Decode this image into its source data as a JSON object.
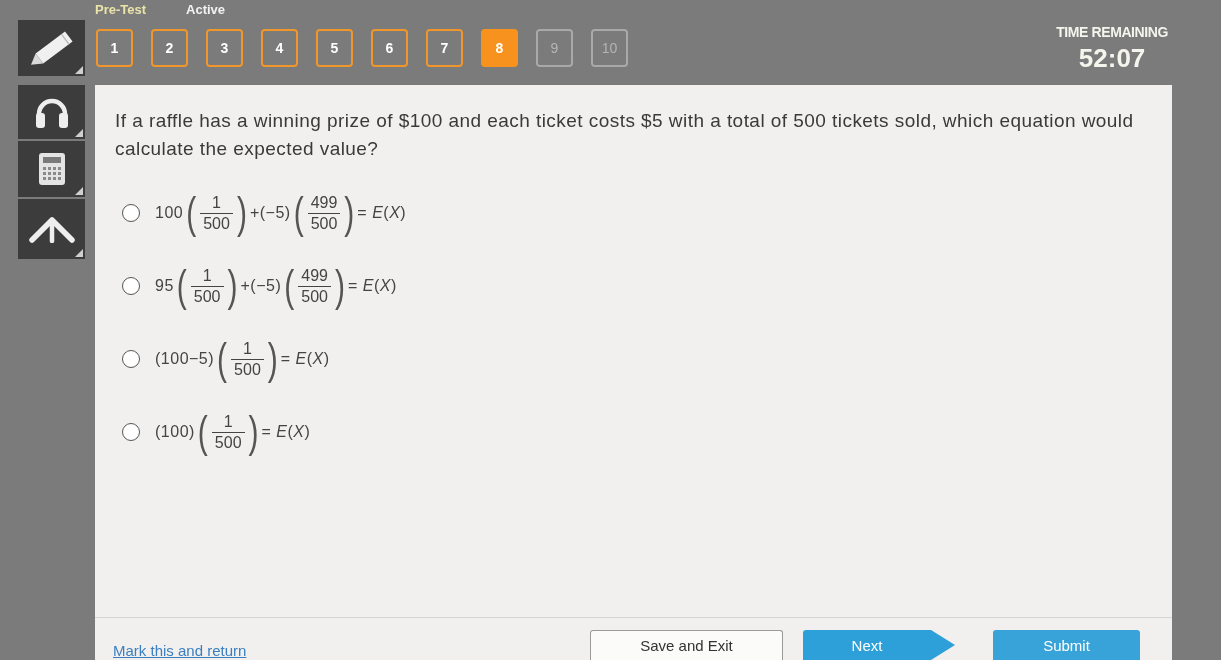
{
  "header": {
    "title": "Pre-Test",
    "status": "Active"
  },
  "question_nav": [
    {
      "label": "1",
      "selected": false,
      "visited": true
    },
    {
      "label": "2",
      "selected": false,
      "visited": true
    },
    {
      "label": "3",
      "selected": false,
      "visited": true
    },
    {
      "label": "4",
      "selected": false,
      "visited": true
    },
    {
      "label": "5",
      "selected": false,
      "visited": true
    },
    {
      "label": "6",
      "selected": false,
      "visited": true
    },
    {
      "label": "7",
      "selected": false,
      "visited": true
    },
    {
      "label": "8",
      "selected": true,
      "visited": true
    },
    {
      "label": "9",
      "selected": false,
      "visited": false
    },
    {
      "label": "10",
      "selected": false,
      "visited": false
    }
  ],
  "timer": {
    "label": "TIME REMAINING",
    "value": "52:07"
  },
  "question": {
    "text": "If a raffle has a winning prize of $100 and each ticket costs $5 with a total of 500 tickets sold, which equation would calculate the expected value?",
    "options": [
      {
        "selected": false,
        "parts": [
          {
            "kind": "text",
            "text": "100"
          },
          {
            "kind": "paren",
            "text": "("
          },
          {
            "kind": "fraction",
            "numerator": "1",
            "denominator": "500"
          },
          {
            "kind": "paren",
            "text": ")"
          },
          {
            "kind": "text",
            "text": "+(−5)"
          },
          {
            "kind": "paren",
            "text": "("
          },
          {
            "kind": "fraction",
            "numerator": "499",
            "denominator": "500"
          },
          {
            "kind": "paren",
            "text": ")"
          },
          {
            "kind": "text",
            "text": "= *E*(*X*)"
          }
        ]
      },
      {
        "selected": false,
        "parts": [
          {
            "kind": "text",
            "text": "95"
          },
          {
            "kind": "paren",
            "text": "("
          },
          {
            "kind": "fraction",
            "numerator": "1",
            "denominator": "500"
          },
          {
            "kind": "paren",
            "text": ")"
          },
          {
            "kind": "text",
            "text": "+(−5)"
          },
          {
            "kind": "paren",
            "text": "("
          },
          {
            "kind": "fraction",
            "numerator": "499",
            "denominator": "500"
          },
          {
            "kind": "paren",
            "text": ")"
          },
          {
            "kind": "text",
            "text": "= *E*(*X*)"
          }
        ]
      },
      {
        "selected": false,
        "parts": [
          {
            "kind": "text",
            "text": "(100−5)"
          },
          {
            "kind": "paren",
            "text": "("
          },
          {
            "kind": "fraction",
            "numerator": "1",
            "denominator": "500"
          },
          {
            "kind": "paren",
            "text": ")"
          },
          {
            "kind": "text",
            "text": "= *E*(*X*)"
          }
        ]
      },
      {
        "selected": false,
        "parts": [
          {
            "kind": "text",
            "text": "(100)"
          },
          {
            "kind": "paren",
            "text": "("
          },
          {
            "kind": "fraction",
            "numerator": "1",
            "denominator": "500"
          },
          {
            "kind": "paren",
            "text": ")"
          },
          {
            "kind": "text",
            "text": "= *E*(*X*)"
          }
        ]
      }
    ]
  },
  "footer": {
    "mark_link": "Mark this and return",
    "buttons": [
      {
        "kind": "secondary",
        "label": "Save and Exit"
      },
      {
        "kind": "next",
        "label": "Next"
      },
      {
        "kind": "primary",
        "label": "Submit"
      }
    ]
  }
}
